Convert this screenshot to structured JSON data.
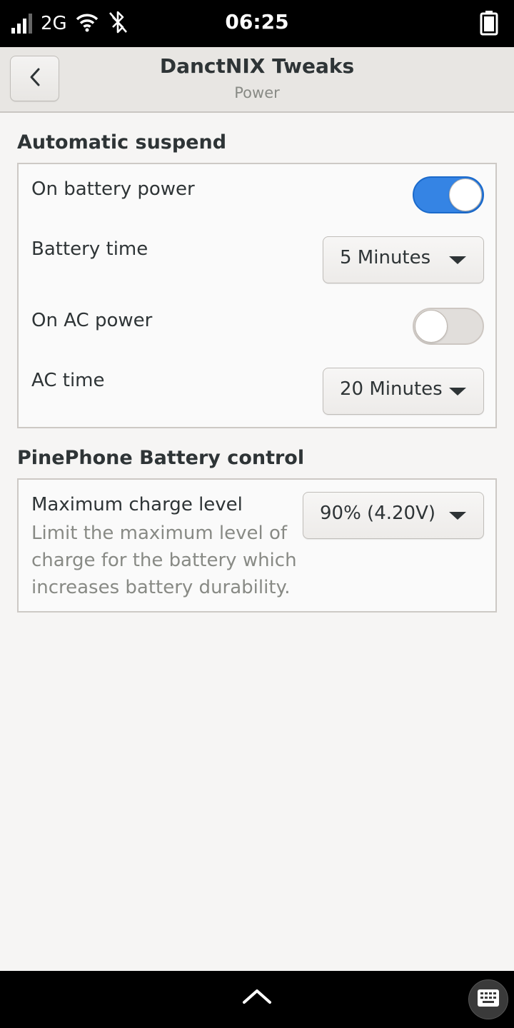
{
  "status_bar": {
    "network": "2G",
    "time": "06:25",
    "icons": [
      "signal-icon",
      "wifi-icon",
      "bluetooth-disabled-icon",
      "battery-icon"
    ]
  },
  "header": {
    "title": "DanctNIX Tweaks",
    "subtitle": "Power",
    "back_icon": "chevron-left-icon"
  },
  "automatic_suspend": {
    "title": "Automatic suspend",
    "on_battery_label": "On battery power",
    "on_battery_enabled": true,
    "battery_time_label": "Battery time",
    "battery_time_value": "5 Minutes",
    "on_ac_label": "On AC power",
    "on_ac_enabled": false,
    "ac_time_label": "AC time",
    "ac_time_value": "20 Minutes"
  },
  "battery_control": {
    "title": "PinePhone Battery control",
    "max_charge_label": "Maximum charge level",
    "max_charge_description": "Limit the maximum level of charge for the battery which increases battery durability.",
    "max_charge_value": "90% (4.20V)"
  },
  "bottom_bar": {
    "icons": [
      "chevron-up-icon",
      "keyboard-icon"
    ]
  },
  "colors": {
    "accent": "#3584e4",
    "background": "#f6f5f4",
    "header": "#e8e6e3"
  }
}
